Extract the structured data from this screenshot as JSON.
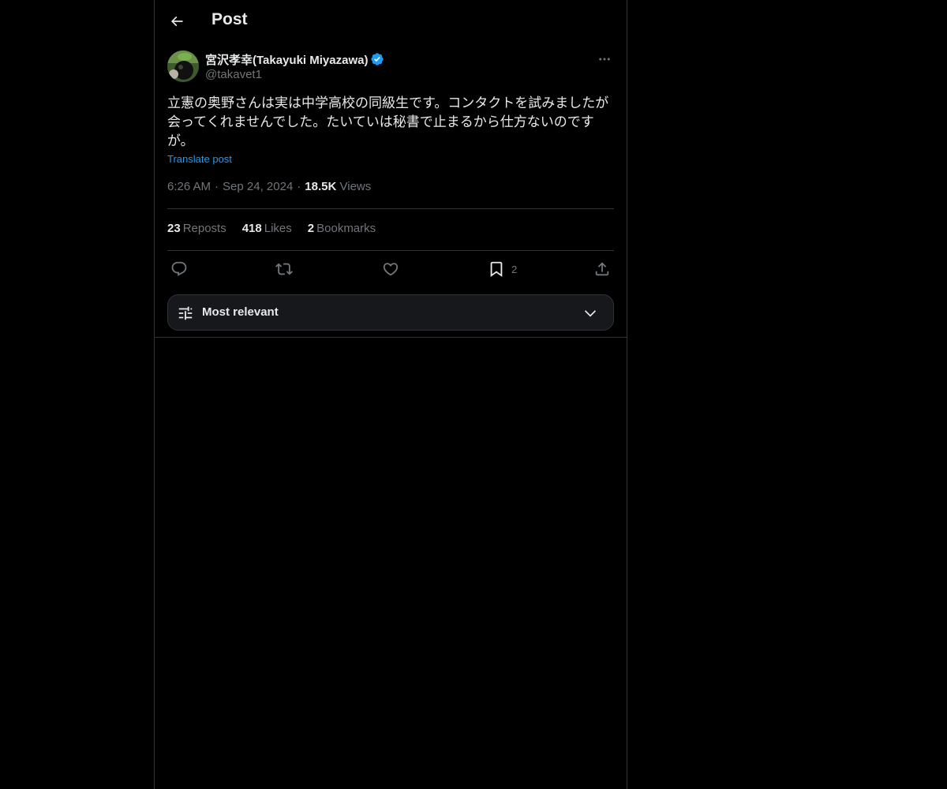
{
  "header": {
    "title": "Post",
    "back_icon": "arrow-left-icon"
  },
  "post": {
    "author": {
      "name": "宮沢孝幸(Takayuki Miyazawa)",
      "handle": "@takavet1",
      "verified": true
    },
    "text": "立憲の奥野さんは実は中学高校の同級生です。コンタクトを試みましたが会ってくれませんでした。たいていは秘書で止まるから仕方ないのですが。",
    "translate_label": "Translate post",
    "time": "6:26 AM",
    "date": "Sep 24, 2024",
    "views_count": "18.5K",
    "views_label": "Views",
    "stats": {
      "reposts_count": "23",
      "reposts_label": "Reposts",
      "likes_count": "418",
      "likes_label": "Likes",
      "bookmarks_count": "2",
      "bookmarks_label": "Bookmarks"
    },
    "actions": {
      "bookmark_count": "2"
    }
  },
  "replies_sort": {
    "label": "Most relevant"
  },
  "colors": {
    "background": "#000000",
    "text": "#e7e9ea",
    "muted": "#71767b",
    "link": "#1d9bf0",
    "border": "#2f3336",
    "verified": "#1d9bf0"
  }
}
